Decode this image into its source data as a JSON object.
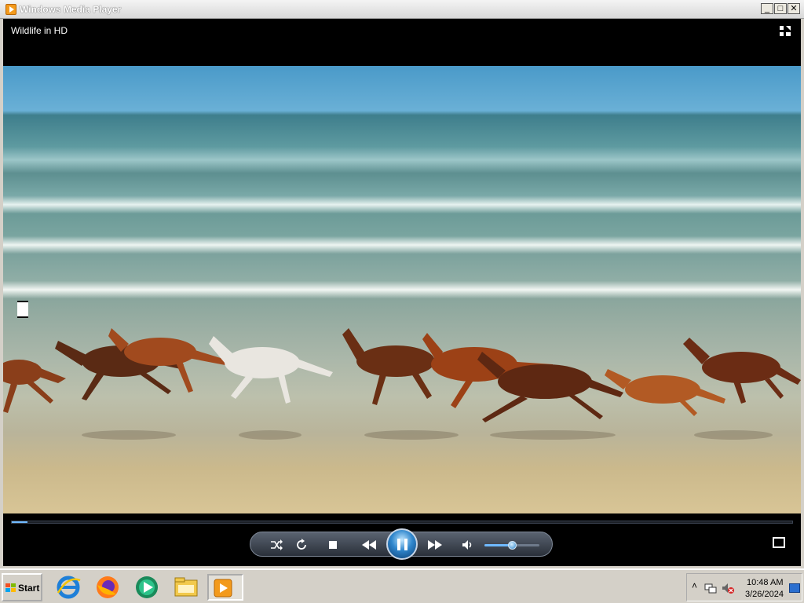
{
  "window": {
    "title": "Windows Media Player",
    "controls": {
      "minimize": "_",
      "maximize": "□",
      "close": "✕"
    }
  },
  "player": {
    "now_playing": "Wildlife in HD",
    "seek_progress": 0.02,
    "volume_level": 0.5,
    "buttons": {
      "shuffle_icon": "shuffle-icon",
      "repeat_icon": "repeat-icon",
      "stop_icon": "stop-icon",
      "previous_icon": "rewind-icon",
      "play_pause_icon": "pause-icon",
      "next_icon": "fast-forward-icon",
      "mute_icon": "speaker-icon"
    },
    "accent_color": "#6fb9ff"
  },
  "taskbar": {
    "start_label": "Start",
    "pinned": [
      {
        "name": "internet-explorer-icon"
      },
      {
        "name": "firefox-icon"
      },
      {
        "name": "media-center-icon"
      },
      {
        "name": "file-explorer-icon"
      },
      {
        "name": "windows-media-player-icon",
        "active": true
      }
    ],
    "tray": {
      "time": "10:48 AM",
      "date": "3/26/2024"
    }
  }
}
